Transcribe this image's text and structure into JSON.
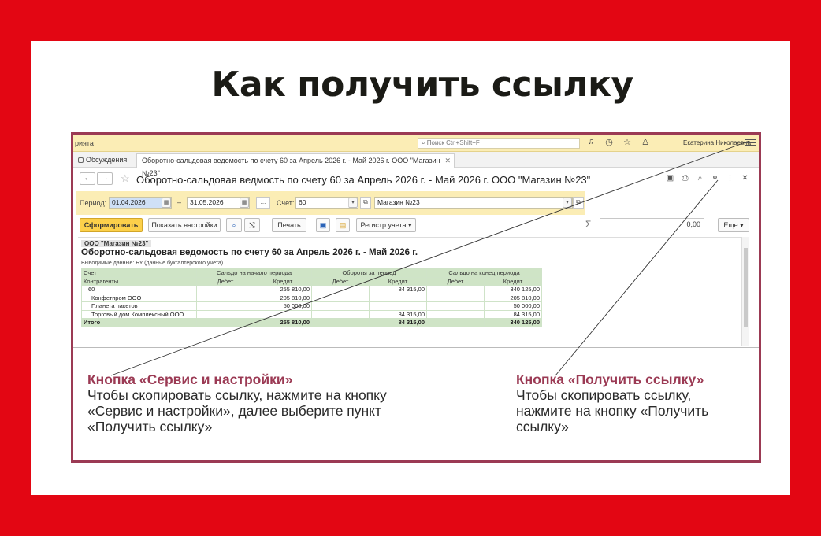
{
  "headline": "Как получить ссылку",
  "app": {
    "app_name": "рията",
    "search_placeholder": "Поиск Ctrl+Shift+F",
    "user_name": "Екатерина Николаевна",
    "tabs": [
      {
        "label": "Обсуждения"
      },
      {
        "label": "Оборотно-сальдовая ведомость по счету 60 за Апрель 2026 г. - Май 2026 г. ООО \"Магазин №23\""
      }
    ],
    "document_title": "Оборотно-сальдовая ведмость по счету 60 за Апрель 2026 г. - Май 2026 г. ООО \"Магазин №23\"",
    "filters": {
      "period_label": "Период:",
      "period_from": "01.04.2026",
      "dash": "–",
      "period_to": "31.05.2026",
      "ellipsis": "...",
      "account_label": "Счет:",
      "account_value": "60",
      "organization": "Магазин №23"
    },
    "toolbar": {
      "generate": "Сформировать",
      "show_settings": "Показать настройки",
      "print": "Печать",
      "register": "Регистр учета",
      "sum_value": "0,00",
      "more": "Еще"
    },
    "report": {
      "organization": "ООО \"Магазин №23\"",
      "title": "Оборотно-сальдовая ведомость по счету 60 за Апрель 2026 г. - Май 2026 г.",
      "subtitle": "Выводимые данные: БУ (данные бухгалтерского учета)",
      "header_row1": [
        "Счет",
        "Сальдо на начало периода",
        "Обороты за период",
        "Сальдо на конец периода"
      ],
      "header_row2": [
        "Контрагенты",
        "Дебет",
        "Кредит",
        "Дебет",
        "Кредит",
        "Дебет",
        "Кредит"
      ],
      "rows": [
        {
          "name": "60",
          "ob_dt": "",
          "ob_kt": "255 810,00",
          "tr_dt": "",
          "tr_kt": "84 315,00",
          "cb_dt": "",
          "cb_kt": "340 125,00"
        },
        {
          "name": "Конфетпром ООО",
          "ob_dt": "",
          "ob_kt": "205 810,00",
          "tr_dt": "",
          "tr_kt": "",
          "cb_dt": "",
          "cb_kt": "205 810,00"
        },
        {
          "name": "Планета пакетов",
          "ob_dt": "",
          "ob_kt": "50 000,00",
          "tr_dt": "",
          "tr_kt": "",
          "cb_dt": "",
          "cb_kt": "50 000,00"
        },
        {
          "name": "Торговый дом Комплексный ООО",
          "ob_dt": "",
          "ob_kt": "",
          "tr_dt": "",
          "tr_kt": "84 315,00",
          "cb_dt": "",
          "cb_kt": "84 315,00"
        }
      ],
      "total": {
        "name": "Итого",
        "ob_kt": "255 810,00",
        "tr_kt": "84 315,00",
        "cb_kt": "340 125,00"
      }
    }
  },
  "captions": {
    "left": {
      "heading": "Кнопка «Сервис и настройки»",
      "lines": [
        "Чтобы скопировать ссылку, нажмите на кнопку",
        "«Сервис и настройки», далее выберите пункт",
        "«Получить ссылку»"
      ]
    },
    "right": {
      "heading": "Кнопка «Получить ссылку»",
      "lines": [
        "Чтобы скопировать ссылку,",
        "нажмите на кнопку «Получить",
        "ссылку»"
      ]
    }
  },
  "colors": {
    "background": "#e30613",
    "frame": "#9b3a54",
    "accent_yellow": "#fcd04a"
  }
}
